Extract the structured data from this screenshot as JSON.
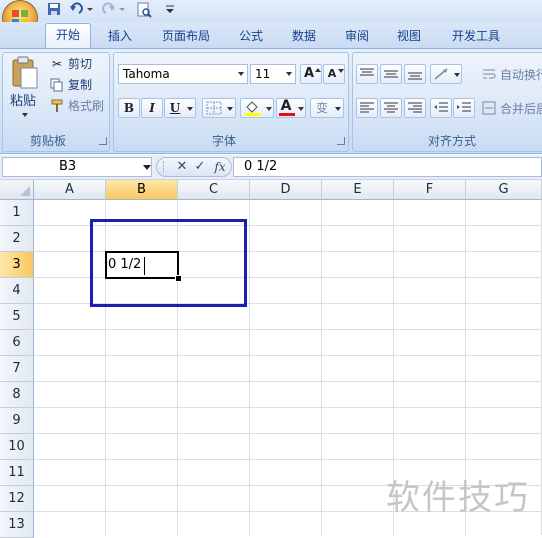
{
  "quick_access": {
    "save_icon": "save-icon",
    "undo_icon": "undo-icon",
    "redo_icon": "redo-icon",
    "preview_icon": "print-preview-icon",
    "customize_icon": "customize-qa-icon"
  },
  "tabs": [
    {
      "label": "开始",
      "active": true
    },
    {
      "label": "插入"
    },
    {
      "label": "页面布局"
    },
    {
      "label": "公式"
    },
    {
      "label": "数据"
    },
    {
      "label": "审阅"
    },
    {
      "label": "视图"
    },
    {
      "label": "开发工具"
    }
  ],
  "clipboard": {
    "paste": "粘贴",
    "cut": "剪切",
    "copy": "复制",
    "format_painter": "格式刷",
    "group": "剪贴板"
  },
  "font": {
    "name": "Tahoma",
    "size": "11",
    "bold": "B",
    "italic": "I",
    "underline": "U",
    "font_color_letter": "A",
    "phonetic": "变",
    "group": "字体",
    "grow": "A",
    "shrink": "A"
  },
  "alignment": {
    "wrap": "自动换行",
    "merge": "合并后居",
    "group": "对齐方式"
  },
  "formula_bar": {
    "name_box": "B3",
    "cancel": "✕",
    "enter": "✓",
    "fx": "fx",
    "content": "0 1/2"
  },
  "columns": [
    "A",
    "B",
    "C",
    "D",
    "E",
    "F",
    "G"
  ],
  "rows": [
    "1",
    "2",
    "3",
    "4",
    "5",
    "6",
    "7",
    "8",
    "9",
    "10",
    "11",
    "12",
    "13"
  ],
  "selected": {
    "column": "B",
    "row": "3",
    "value": "0 1/2"
  },
  "watermark": "软件技巧",
  "colors": {
    "accent": "#f8c85f",
    "highlight_box": "#1a1fb0",
    "ribbon": "#d4e3f6"
  }
}
